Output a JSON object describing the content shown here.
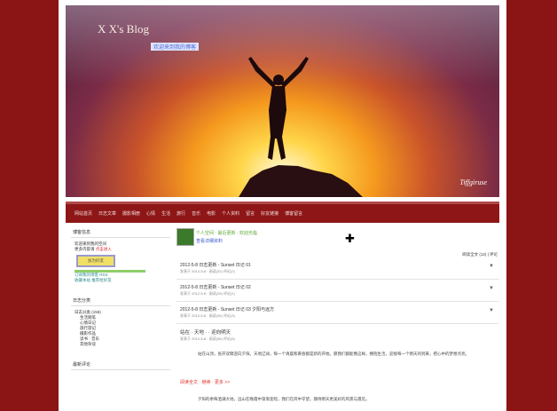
{
  "banner": {
    "title": "X X's Blog",
    "subtitle": "欢迎来到我的博客",
    "signature": "Tiffgiruse"
  },
  "nav": {
    "items": [
      "网站首页",
      "日志文章",
      "摄影相册",
      "心情",
      "生活",
      "旅行",
      "音乐",
      "电影",
      "个人资料",
      "留言",
      "好友链接",
      "博客留言"
    ]
  },
  "sidebar": {
    "widget1_title": "博客信息",
    "status_text": "欢迎来到我的空间",
    "status_link": "更多内容请",
    "status_red": "点击进入",
    "yellow_button": "加为好友",
    "small_link1": "订阅我的博客 RSS",
    "small_link2": "收藏本站 推荐给好友",
    "widget2_title": "日志分类",
    "categories": [
      "日志分类 (156)",
      "生活随笔",
      "心情日记",
      "旅行游记",
      "摄影作品",
      "读书 · 音乐",
      "其他杂谈"
    ],
    "widget3_title": "最新评论"
  },
  "main": {
    "head_green": "个人空间 · 最近更新 · 欢迎光临",
    "head_link": "查看详细资料",
    "meta_right": "阅读全文 (12) | 评论",
    "rows": [
      {
        "title": "2012-5-8 日志更新 - Sunset 日记 01",
        "sub": "发表于 2012-5-8 · 阅读(32) 评论(2)",
        "arrow": "▼"
      },
      {
        "title": "2012-5-8 日志更新 - Sunset 日记 02",
        "sub": "发表于 2012-5-8 · 阅读(28) 评论(1)",
        "arrow": "▼"
      },
      {
        "title": "2012-5-8 日志更新 - Sunset 日记 03 夕阳与远方",
        "sub": "发表于 2012-5-8 · 阅读(45) 评论(3)",
        "arrow": "▼"
      }
    ],
    "article_title": "站在 · 天地 · · 迎向明天",
    "article_sub": "发表于 2012-5-8 · 阅读(56) 评论(5)",
    "article_body": "站在山顶，张开双臂迎向夕阳。天地辽阔，每一个清晨和黄昏都是新的开始。愿我们都能像这样，拥抱生活，迎接每一个明天的到来，把心中的梦想点亮。",
    "article_red": "阅读全文 · 继续 · 更多 >>",
    "article_body2": "夕阳的余晖洒满大地，远山在晚霞中渐渐变暗，我们在风中守望，期待明天更美好的风景与遇见。"
  }
}
